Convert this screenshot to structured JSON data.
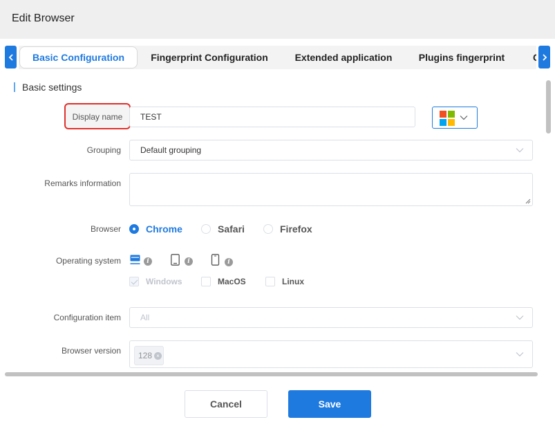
{
  "window": {
    "title": "Edit Browser"
  },
  "tabs": [
    {
      "label": "Basic Configuration",
      "active": true
    },
    {
      "label": "Fingerprint Configuration",
      "active": false
    },
    {
      "label": "Extended application",
      "active": false
    },
    {
      "label": "Plugins fingerprint",
      "active": false
    }
  ],
  "section": {
    "title": "Basic settings"
  },
  "form": {
    "display_name": {
      "label": "Display name",
      "value": "TEST"
    },
    "grouping": {
      "label": "Grouping",
      "value": "Default grouping"
    },
    "remarks": {
      "label": "Remarks information",
      "value": ""
    },
    "browser": {
      "label": "Browser",
      "options": [
        "Chrome",
        "Safari",
        "Firefox"
      ],
      "selected": "Chrome"
    },
    "operating_system": {
      "label": "Operating system",
      "device_icons": [
        "desktop-icon",
        "tablet-icon",
        "mobile-icon"
      ],
      "options": [
        {
          "label": "Windows",
          "checked": true,
          "disabled": true
        },
        {
          "label": "MacOS",
          "checked": false,
          "disabled": false
        },
        {
          "label": "Linux",
          "checked": false,
          "disabled": false
        }
      ]
    },
    "configuration_item": {
      "label": "Configuration item",
      "placeholder": "All"
    },
    "browser_version": {
      "label": "Browser version",
      "tag": "128"
    }
  },
  "footer": {
    "cancel_label": "Cancel",
    "save_label": "Save"
  },
  "colors": {
    "accent": "#1f7ae0",
    "highlight_border": "#e0302b",
    "windows_logo": [
      "#f25022",
      "#7fba00",
      "#00a4ef",
      "#ffb900"
    ]
  }
}
